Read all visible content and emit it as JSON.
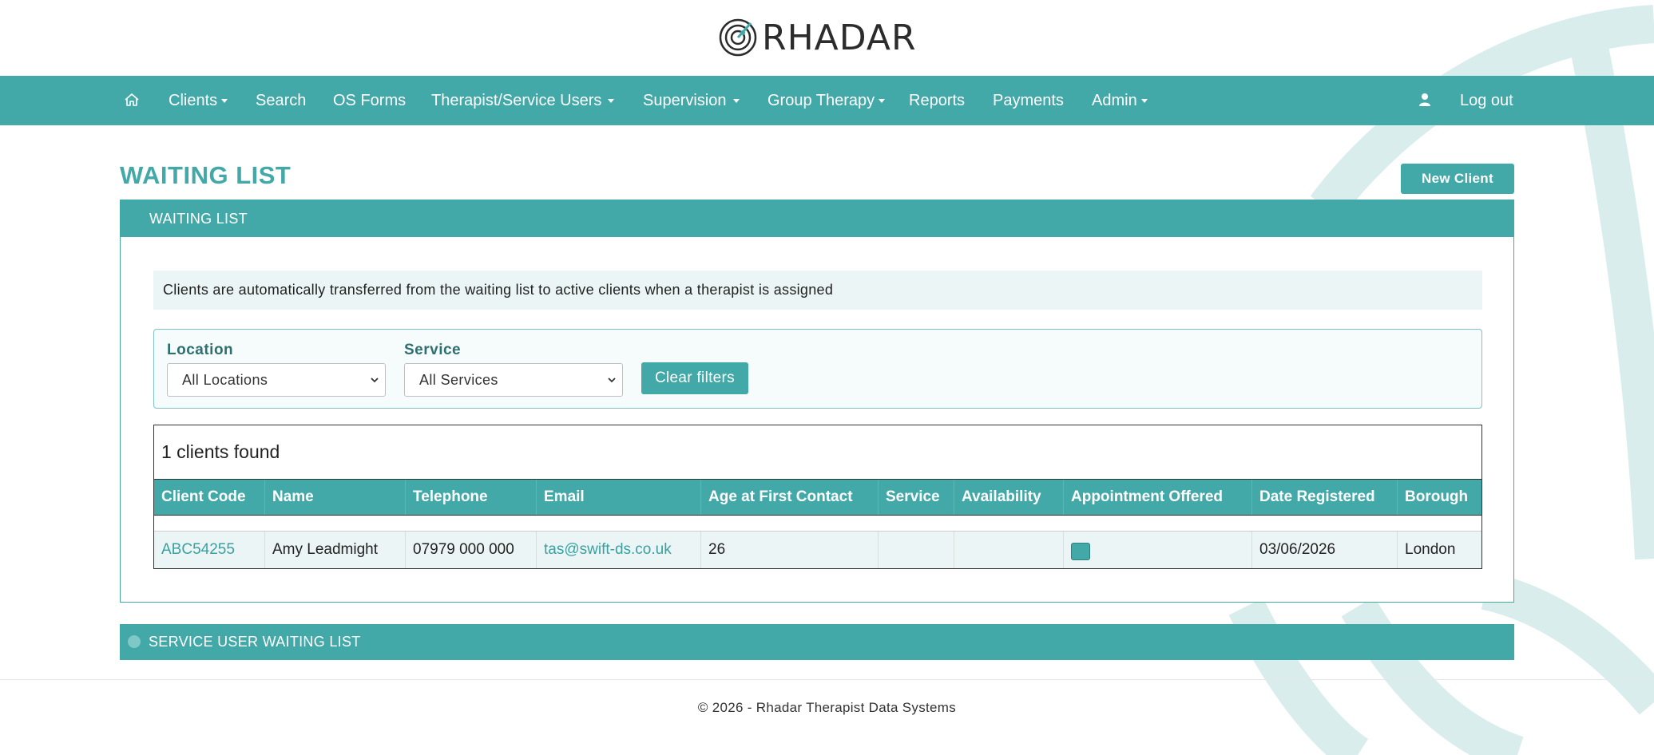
{
  "brand": {
    "name": "RHADAR"
  },
  "nav": {
    "items": [
      {
        "label": "Clients",
        "dropdown": true
      },
      {
        "label": "Search",
        "dropdown": false
      },
      {
        "label": "OS Forms",
        "dropdown": false
      },
      {
        "label": "Therapist/Service Users",
        "dropdown": true
      },
      {
        "label": "Supervision",
        "dropdown": true
      },
      {
        "label": "Group Therapy",
        "dropdown": true
      },
      {
        "label": "Reports",
        "dropdown": false
      },
      {
        "label": "Payments",
        "dropdown": false
      },
      {
        "label": "Admin",
        "dropdown": true
      }
    ],
    "logout_label": "Log out"
  },
  "page": {
    "title": "WAITING LIST",
    "new_client_label": "New Client"
  },
  "waiting_panel": {
    "heading": "WAITING LIST",
    "info": "Clients are automatically transferred from the waiting list to active clients when a therapist is assigned",
    "filters": {
      "location_label": "Location",
      "location_value": "All Locations",
      "service_label": "Service",
      "service_value": "All Services",
      "clear_label": "Clear filters"
    },
    "results_count": "1 clients found",
    "columns": [
      "Client Code",
      "Name",
      "Telephone",
      "Email",
      "Age at First Contact",
      "Service",
      "Availability",
      "Appointment Offered",
      "Date Registered",
      "Borough"
    ],
    "rows": [
      {
        "client_code": "ABC54255",
        "name": "Amy Leadmight",
        "telephone": "07979 000 000",
        "email": "tas@swift-ds.co.uk",
        "age": "26",
        "service": "",
        "availability": "",
        "appointment_offered": true,
        "date_registered": "03/06/2026",
        "borough": "London"
      }
    ]
  },
  "service_user_panel": {
    "heading": "SERVICE USER WAITING LIST"
  },
  "footer": {
    "text": "© 2026 - Rhadar Therapist Data Systems"
  },
  "colors": {
    "accent": "#42a8a8",
    "info_bg": "#ebf5f5",
    "row_bg": "#ecf5f5"
  },
  "icons": {
    "home": "home-icon",
    "user": "user-icon",
    "logo": "radar-icon"
  }
}
